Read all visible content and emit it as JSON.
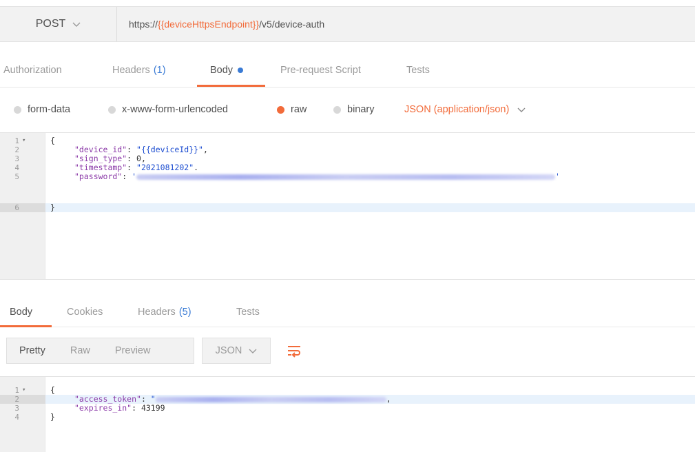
{
  "request": {
    "method": "POST",
    "url": {
      "prefix": "https://",
      "variable": "{{deviceHttpsEndpoint}}",
      "suffix": "/v5/device-auth"
    }
  },
  "request_tabs": [
    {
      "label": "Authorization"
    },
    {
      "label": "Headers",
      "count": "(1)"
    },
    {
      "label": "Body",
      "active": true
    },
    {
      "label": "Pre-request Script"
    },
    {
      "label": "Tests"
    }
  ],
  "body_types": [
    {
      "label": "form-data",
      "selected": false
    },
    {
      "label": "x-www-form-urlencoded",
      "selected": false
    },
    {
      "label": "raw",
      "selected": true
    },
    {
      "label": "binary",
      "selected": false
    }
  ],
  "body_format": "JSON (application/json)",
  "request_body": {
    "line_numbers": [
      "1",
      "2",
      "3",
      "4",
      "5",
      "6"
    ],
    "brace_open": "{",
    "brace_close": "}",
    "fields": [
      {
        "key": "\"device_id\"",
        "value": "\"{{deviceId}}\"",
        "trail": ","
      },
      {
        "key": "\"sign_type\"",
        "value": "0",
        "trail": ","
      },
      {
        "key": "\"timestamp\"",
        "value": "\"2021081202\"",
        "trail": "."
      },
      {
        "key": "\"password\"",
        "value": "'",
        "trail": "'"
      }
    ]
  },
  "response_tabs": [
    {
      "label": "Body",
      "active": true
    },
    {
      "label": "Cookies"
    },
    {
      "label": "Headers",
      "count": "(5)"
    },
    {
      "label": "Tests"
    }
  ],
  "view_modes": [
    {
      "label": "Pretty",
      "active": true
    },
    {
      "label": "Raw"
    },
    {
      "label": "Preview"
    }
  ],
  "response_format": "JSON",
  "response_body": {
    "line_numbers": [
      "1",
      "2",
      "3",
      "4"
    ],
    "brace_open": "{",
    "brace_close": "}",
    "fields": [
      {
        "key": "\"access_token\"",
        "value": "\"",
        "trail": ","
      },
      {
        "key": "\"expires_in\"",
        "value": "43199",
        "trail": ""
      }
    ]
  },
  "icons": {
    "method_dropdown": "chevron-down-icon",
    "format_dropdown": "chevron-down-icon",
    "wrap": "wrap-lines-icon",
    "fold": "fold-arrow-icon"
  },
  "colors": {
    "accent": "#f26b3a",
    "link": "#3a7bd5",
    "json_key": "#8b3aa8",
    "json_string": "#1a4bd0"
  }
}
